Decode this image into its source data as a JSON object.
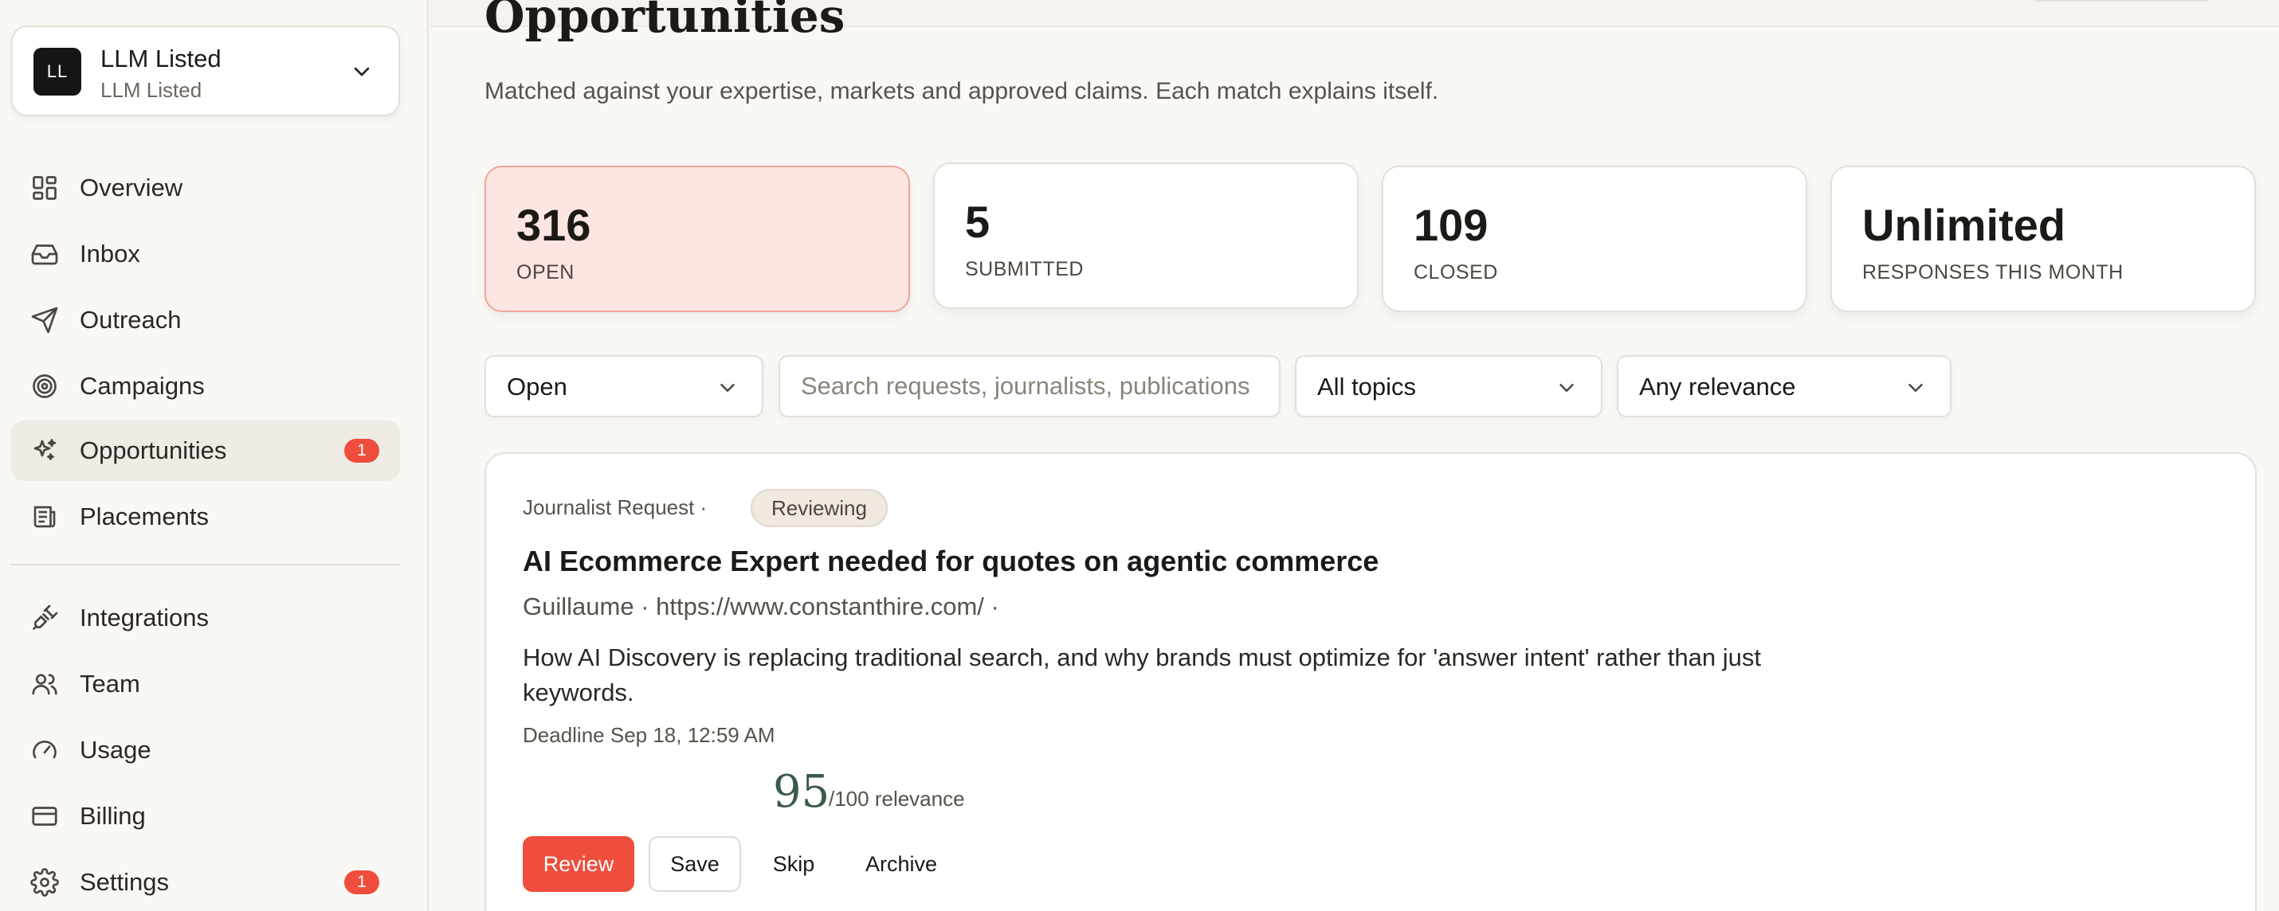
{
  "sidebar": {
    "org": {
      "initials": "LL",
      "name": "LLM Listed",
      "subtitle": "LLM Listed"
    },
    "items": [
      {
        "label": "Overview",
        "icon": "grid-icon"
      },
      {
        "label": "Inbox",
        "icon": "inbox-icon"
      },
      {
        "label": "Outreach",
        "icon": "send-icon"
      },
      {
        "label": "Campaigns",
        "icon": "target-icon"
      },
      {
        "label": "Opportunities",
        "icon": "sparkles-icon",
        "active": true,
        "badge": "1"
      },
      {
        "label": "Placements",
        "icon": "newspaper-icon"
      },
      {
        "label": "Integrations",
        "icon": "plug-icon"
      },
      {
        "label": "Team",
        "icon": "users-icon"
      },
      {
        "label": "Usage",
        "icon": "gauge-icon"
      },
      {
        "label": "Billing",
        "icon": "credit-card-icon"
      },
      {
        "label": "Settings",
        "icon": "gear-icon",
        "badge": "1"
      }
    ]
  },
  "main": {
    "title": "Opportunities",
    "subtitle": "Matched against your expertise, markets and approved claims. Each match explains itself.",
    "stats": [
      {
        "value": "316",
        "label": "OPEN"
      },
      {
        "value": "5",
        "label": "SUBMITTED"
      },
      {
        "value": "109",
        "label": "CLOSED"
      },
      {
        "value": "Unlimited",
        "label": "RESPONSES THIS MONTH"
      }
    ],
    "filters": {
      "status": "Open",
      "search_placeholder": "Search requests, journalists, publications",
      "topics": "All topics",
      "relevance": "Any relevance"
    },
    "request": {
      "type": "Journalist Request ·",
      "status": "Reviewing",
      "title": "AI Ecommerce Expert needed for quotes on agentic commerce",
      "meta": "Guillaume · https://www.constanthire.com/ ·",
      "description": "How AI Discovery is replacing traditional search, and why brands must optimize for 'answer intent' rather than just keywords.",
      "deadline": "Deadline Sep 18, 12:59 AM",
      "score": "95",
      "score_suffix": "/100 relevance",
      "actions": {
        "review": "Review",
        "save": "Save",
        "skip": "Skip",
        "archive": "Archive"
      }
    }
  },
  "colors": {
    "accent": "#ef4d3d",
    "active_card": "#fde6e2",
    "score": "#3c5a48"
  }
}
